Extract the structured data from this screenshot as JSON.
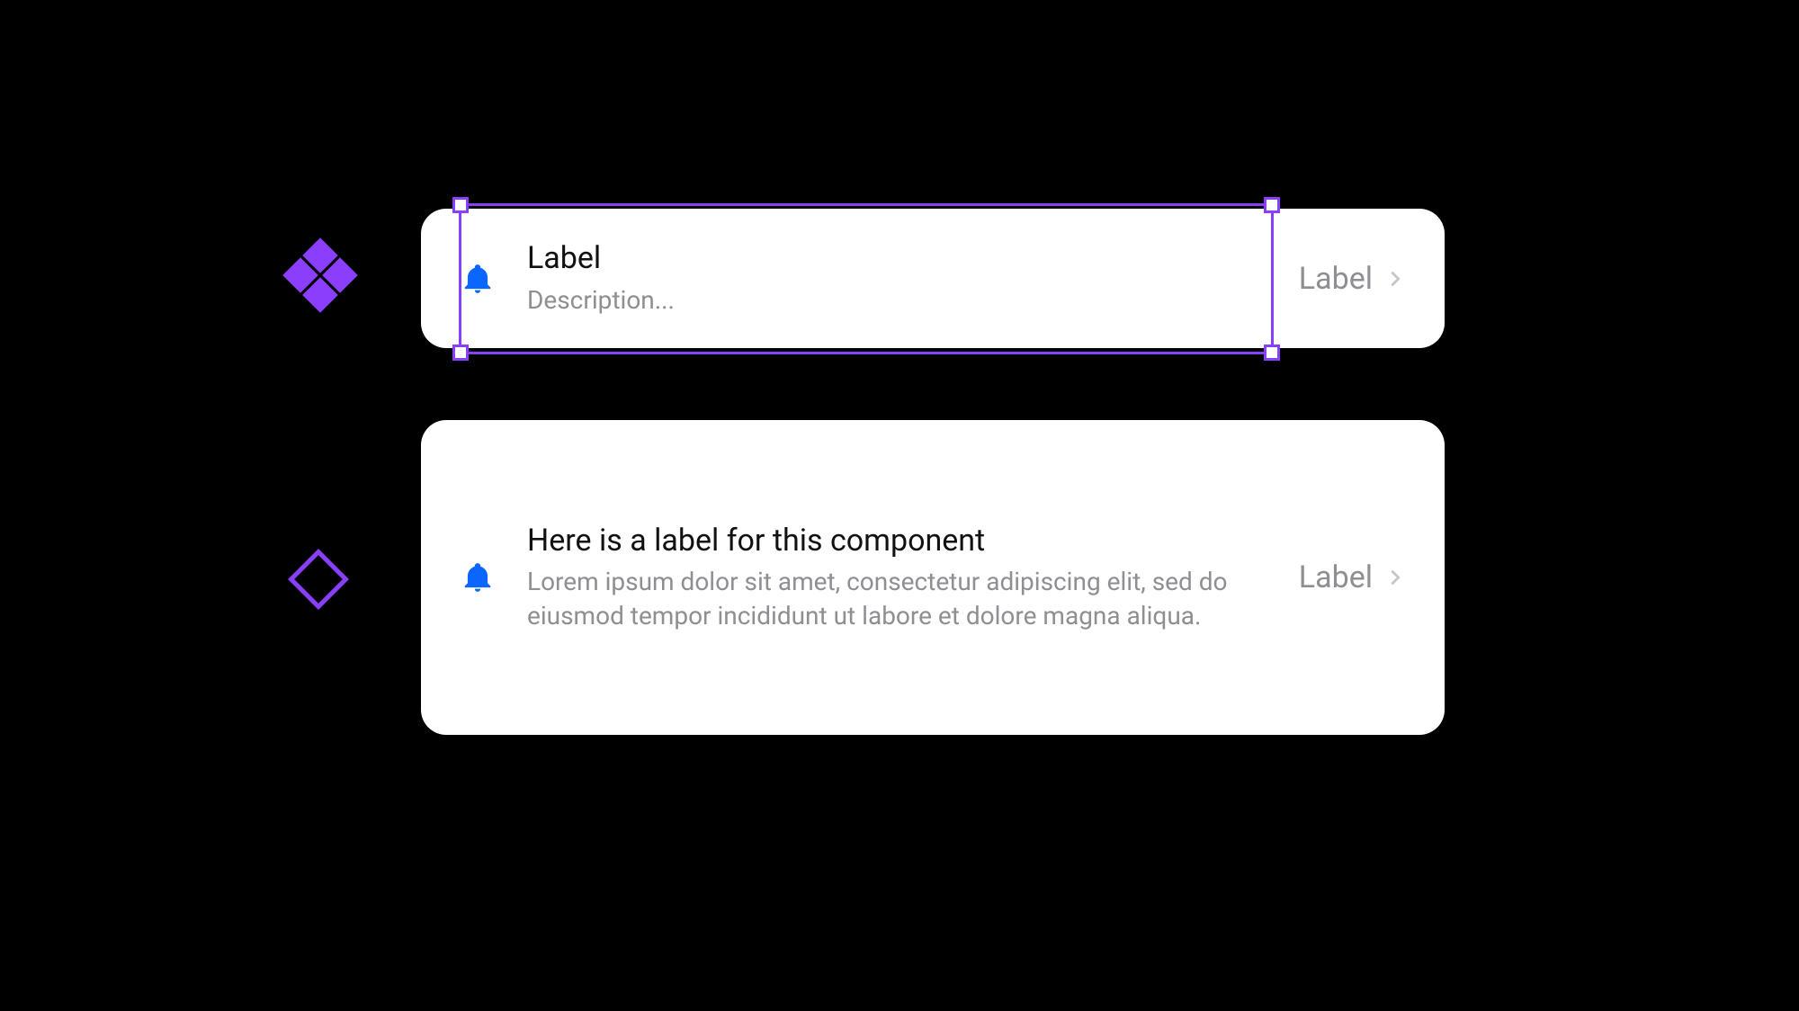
{
  "colors": {
    "accent_purple": "#8a3ffc",
    "icon_blue": "#0a66ff",
    "text_primary": "#111111",
    "text_secondary": "#8e8e93",
    "background": "#000000",
    "card_background": "#ffffff"
  },
  "card1": {
    "title": "Label",
    "description": "Description...",
    "trailing_label": "Label"
  },
  "card2": {
    "title": "Here is a label for this component",
    "description": "Lorem ipsum dolor sit amet, consectetur adipiscing elit, sed do eiusmod tempor incididunt ut labore et dolore magna aliqua.",
    "trailing_label": "Label"
  },
  "icons": {
    "bell": "bell-icon",
    "chevron": "chevron-right-icon",
    "component_filled": "component-filled-icon",
    "component_outline": "component-outline-icon"
  }
}
